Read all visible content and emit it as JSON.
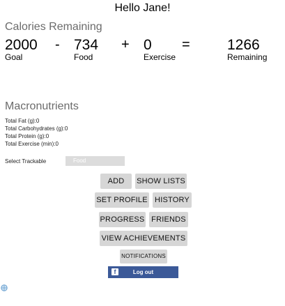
{
  "greeting": "Hello Jane!",
  "calories": {
    "title": "Calories Remaining",
    "goal_value": "2000",
    "goal_label": "Goal",
    "minus": "-",
    "food_value": "734",
    "food_label": "Food",
    "plus": "+",
    "exercise_value": "0",
    "exercise_label": "Exercise",
    "equals": "=",
    "remaining_value": "1266",
    "remaining_label": "Remaining"
  },
  "macros": {
    "title": "Macronutrients",
    "fat": "Total Fat (g):0",
    "carbs": "Total Carbohydrates (g):0",
    "protein": "Total Protein (g):0",
    "exercise": "Total Exercise (min):0"
  },
  "trackable": {
    "label": "Select Trackable",
    "selected": "Food"
  },
  "buttons": {
    "add": "ADD",
    "show_lists": "SHOW LISTS",
    "set_profile": "SET PROFILE",
    "history": "HISTORY",
    "progress": "PROGRESS",
    "friends": "FRIENDS",
    "view_achievements": "VIEW ACHIEVEMENTS",
    "notifications": "NOTIFICATIONS"
  },
  "facebook": {
    "icon": "facebook-icon",
    "logout_label": "Log out",
    "color": "#3b5998"
  },
  "icons": {
    "corner": "bug-icon"
  }
}
